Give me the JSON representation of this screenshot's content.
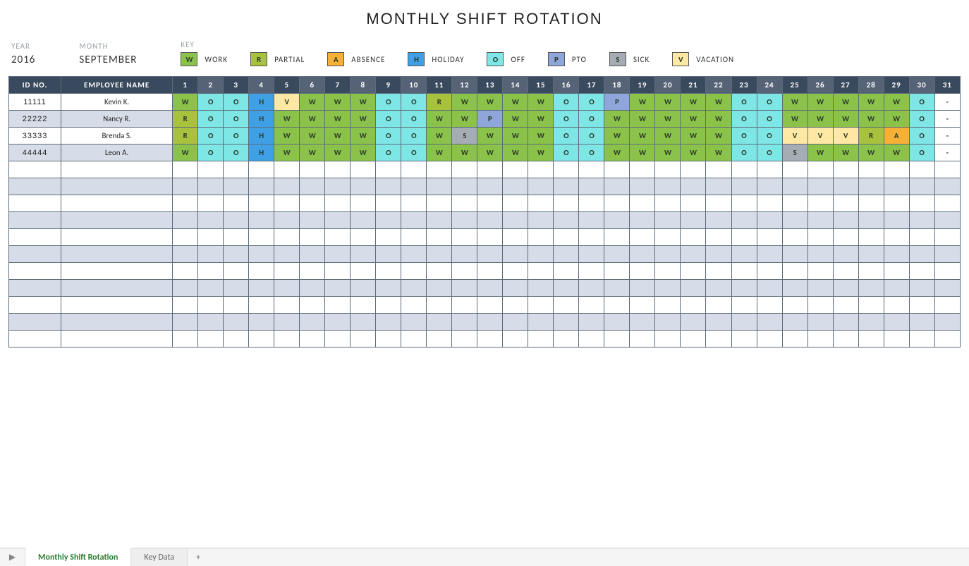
{
  "title": "MONTHLY SHIFT ROTATION",
  "meta": {
    "year_label": "YEAR",
    "year_value": "2016",
    "month_label": "MONTH",
    "month_value": "SEPTEMBER",
    "key_label": "KEY"
  },
  "key_items": [
    {
      "code": "W",
      "label": "WORK",
      "color": "#8bc34a"
    },
    {
      "code": "R",
      "label": "PARTIAL",
      "color": "#a8c23d"
    },
    {
      "code": "A",
      "label": "ABSENCE",
      "color": "#f6b035"
    },
    {
      "code": "H",
      "label": "HOLIDAY",
      "color": "#3fa0e6"
    },
    {
      "code": "O",
      "label": "OFF",
      "color": "#7fe6e6"
    },
    {
      "code": "P",
      "label": "PTO",
      "color": "#8ea6d9"
    },
    {
      "code": "S",
      "label": "SICK",
      "color": "#a6acb4"
    },
    {
      "code": "V",
      "label": "VACATION",
      "color": "#ffe8a3"
    }
  ],
  "columns": {
    "id_header": "ID NO.",
    "name_header": "EMPLOYEE NAME",
    "days": [
      "1",
      "2",
      "3",
      "4",
      "5",
      "6",
      "7",
      "8",
      "9",
      "10",
      "11",
      "12",
      "13",
      "14",
      "15",
      "16",
      "17",
      "18",
      "19",
      "20",
      "21",
      "22",
      "23",
      "24",
      "25",
      "26",
      "27",
      "28",
      "29",
      "30",
      "31"
    ]
  },
  "employees": [
    {
      "id": "11111",
      "name": "Kevin K.",
      "shifts": [
        "W",
        "O",
        "O",
        "H",
        "V",
        "W",
        "W",
        "W",
        "O",
        "O",
        "R",
        "W",
        "W",
        "W",
        "W",
        "O",
        "O",
        "P",
        "W",
        "W",
        "W",
        "W",
        "O",
        "O",
        "W",
        "W",
        "W",
        "W",
        "W",
        "O",
        "-"
      ]
    },
    {
      "id": "22222",
      "name": "Nancy R.",
      "shifts": [
        "R",
        "O",
        "O",
        "H",
        "W",
        "W",
        "W",
        "W",
        "O",
        "O",
        "W",
        "W",
        "P",
        "W",
        "W",
        "O",
        "O",
        "W",
        "W",
        "W",
        "W",
        "W",
        "O",
        "O",
        "W",
        "W",
        "W",
        "W",
        "W",
        "O",
        "-"
      ]
    },
    {
      "id": "33333",
      "name": "Brenda S.",
      "shifts": [
        "R",
        "O",
        "O",
        "H",
        "W",
        "W",
        "W",
        "W",
        "O",
        "O",
        "W",
        "S",
        "W",
        "W",
        "W",
        "O",
        "O",
        "W",
        "W",
        "W",
        "W",
        "W",
        "O",
        "O",
        "V",
        "V",
        "V",
        "R",
        "A",
        "O",
        "-"
      ]
    },
    {
      "id": "44444",
      "name": "Leon A.",
      "shifts": [
        "W",
        "O",
        "O",
        "H",
        "W",
        "W",
        "W",
        "W",
        "O",
        "O",
        "W",
        "W",
        "W",
        "W",
        "W",
        "O",
        "O",
        "W",
        "W",
        "W",
        "W",
        "W",
        "O",
        "O",
        "S",
        "W",
        "W",
        "W",
        "W",
        "O",
        "-"
      ]
    }
  ],
  "empty_rows": 11,
  "tabs": {
    "active": "Monthly Shift Rotation",
    "other": "Key Data"
  }
}
